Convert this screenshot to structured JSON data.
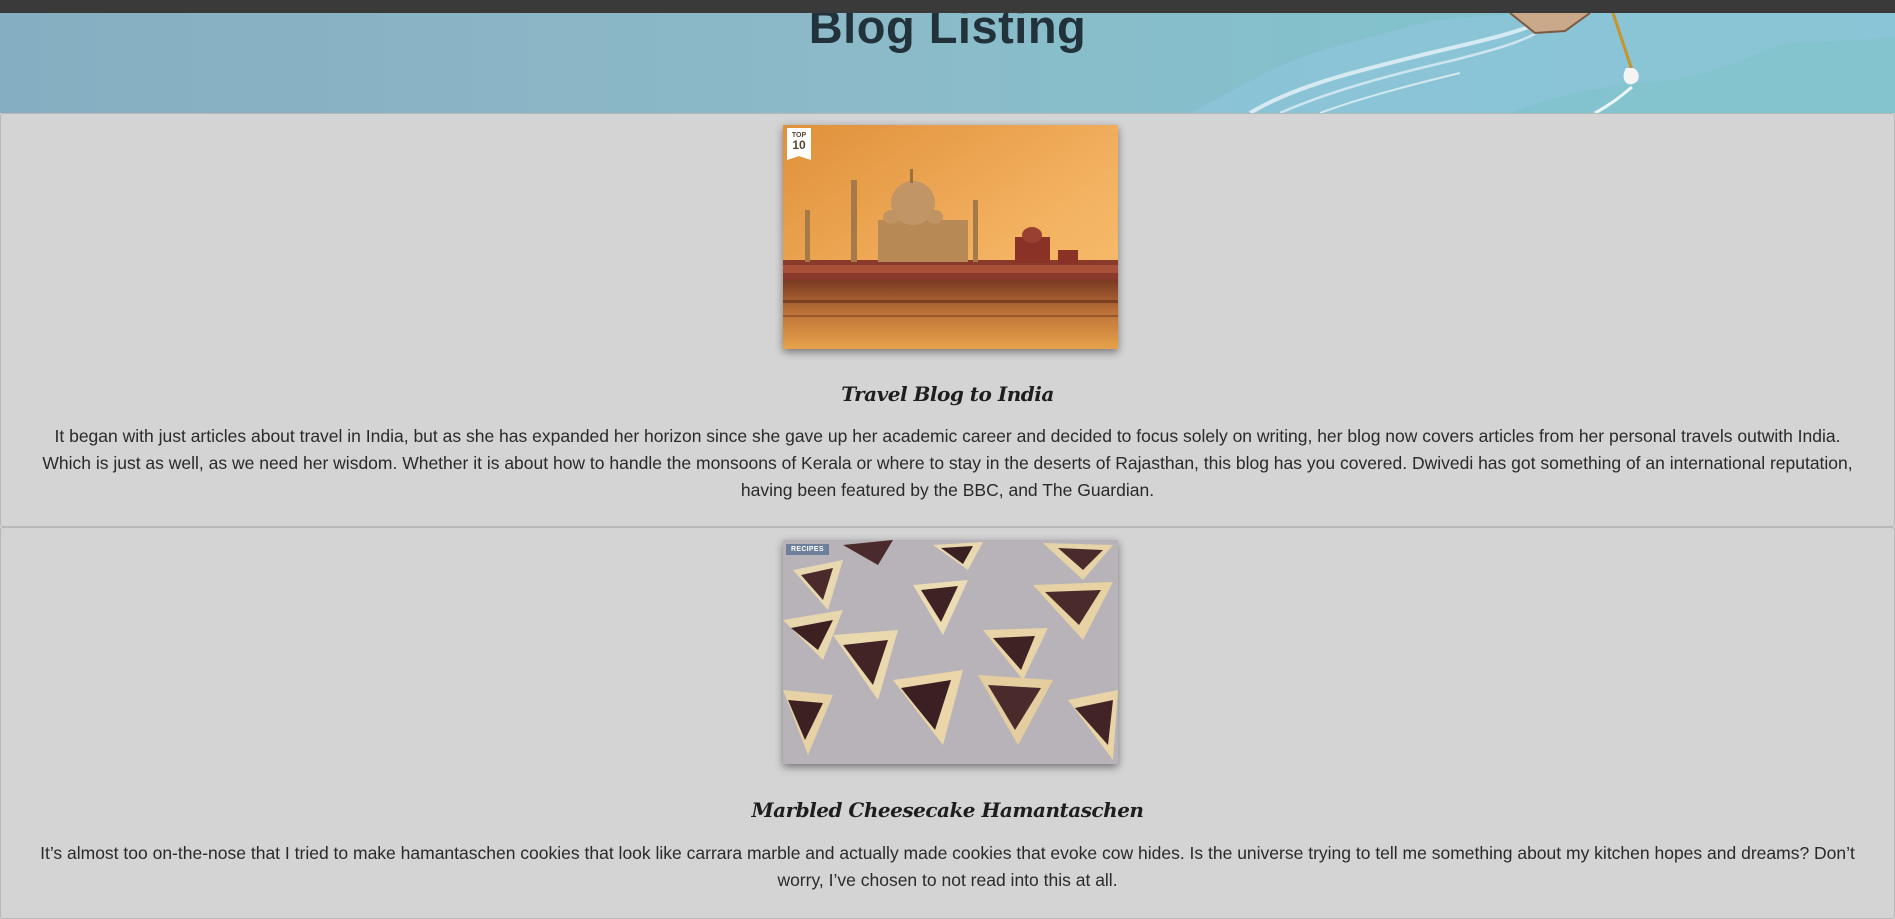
{
  "header": {
    "title": "Blog Listing"
  },
  "posts": [
    {
      "title": "Travel Blog to India",
      "badge_line1": "TOP",
      "badge_line2": "10",
      "excerpt": "It began with just articles about travel in India, but as she has expanded her horizon since she gave up her academic career and decided to focus solely on writing, her blog now covers articles from her personal travels outwith India. Which is just as well, as we need her wisdom. Whether it is about how to handle the monsoons of Kerala or where to stay in the deserts of Rajasthan, this blog has you covered. Dwivedi has got something of an international reputation, having been featured by the BBC, and The Guardian."
    },
    {
      "title": "Marbled Cheesecake Hamantaschen",
      "badge": "RECIPES",
      "excerpt": "It’s almost too on-the-nose that I tried to make hamantaschen cookies that look like carrara marble and actually made cookies that evoke cow hides. Is the universe trying to tell me something about my kitchen hopes and dreams? Don’t worry, I’ve chosen to not read into this at all."
    }
  ]
}
